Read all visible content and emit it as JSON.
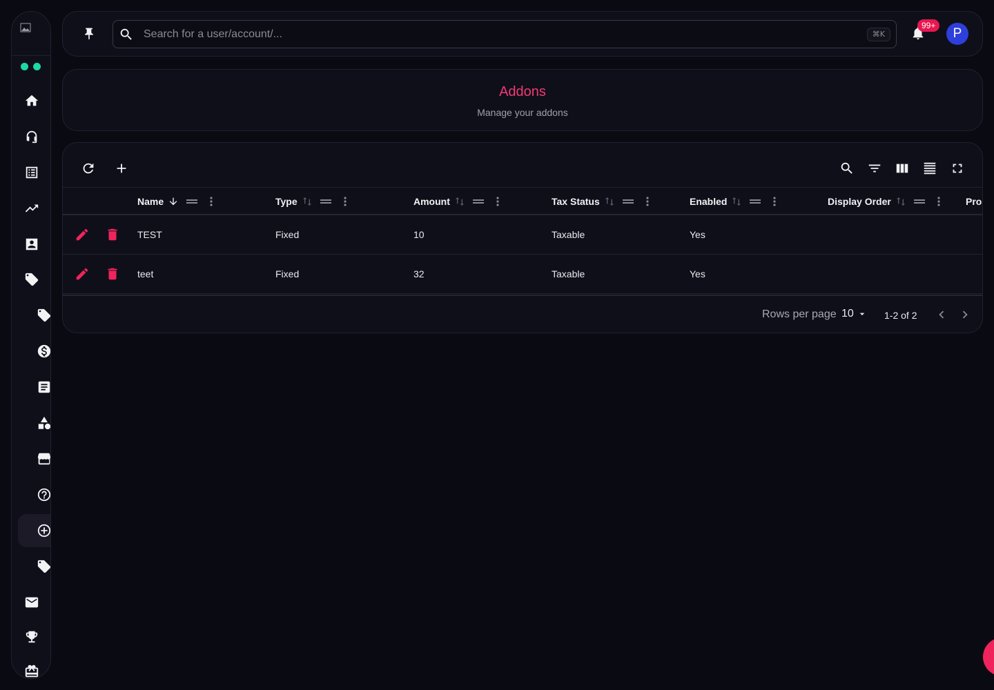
{
  "sidebar": {
    "items": [
      {
        "name": "home-icon"
      },
      {
        "name": "support-icon"
      },
      {
        "name": "list-icon"
      },
      {
        "name": "trending-icon"
      },
      {
        "name": "contact-icon"
      },
      {
        "name": "tag-icon"
      },
      {
        "name": "tag-sub-icon"
      },
      {
        "name": "dollar-icon"
      },
      {
        "name": "article-icon"
      },
      {
        "name": "category-icon"
      },
      {
        "name": "store-icon"
      },
      {
        "name": "help-icon"
      },
      {
        "name": "add-circle-icon",
        "active": true
      },
      {
        "name": "tag-sub-icon-2"
      },
      {
        "name": "mail-icon"
      },
      {
        "name": "trophy-icon"
      },
      {
        "name": "gift-icon"
      }
    ]
  },
  "header": {
    "search_placeholder": "Search for a user/account/...",
    "shortcut": "⌘K",
    "notification_badge": "99+",
    "avatar_initial": "P"
  },
  "page": {
    "title": "Addons",
    "subtitle": "Manage your addons"
  },
  "table": {
    "columns": [
      {
        "label": "Name",
        "sorted": "desc"
      },
      {
        "label": "Type"
      },
      {
        "label": "Amount"
      },
      {
        "label": "Tax Status"
      },
      {
        "label": "Enabled"
      },
      {
        "label": "Display Order"
      },
      {
        "label": "Pro"
      }
    ],
    "rows": [
      {
        "name": "TEST",
        "type": "Fixed",
        "amount": "10",
        "tax_status": "Taxable",
        "enabled": "Yes",
        "display_order": ""
      },
      {
        "name": "teet",
        "type": "Fixed",
        "amount": "32",
        "tax_status": "Taxable",
        "enabled": "Yes",
        "display_order": ""
      }
    ],
    "footer": {
      "rows_per_page_label": "Rows per page",
      "rows_per_page_value": "10",
      "range": "1-2 of 2"
    }
  },
  "colors": {
    "accent": "#f0245c",
    "title": "#f23a74",
    "status_dot": "#1ed8a6",
    "avatar": "#2e3fdc"
  }
}
